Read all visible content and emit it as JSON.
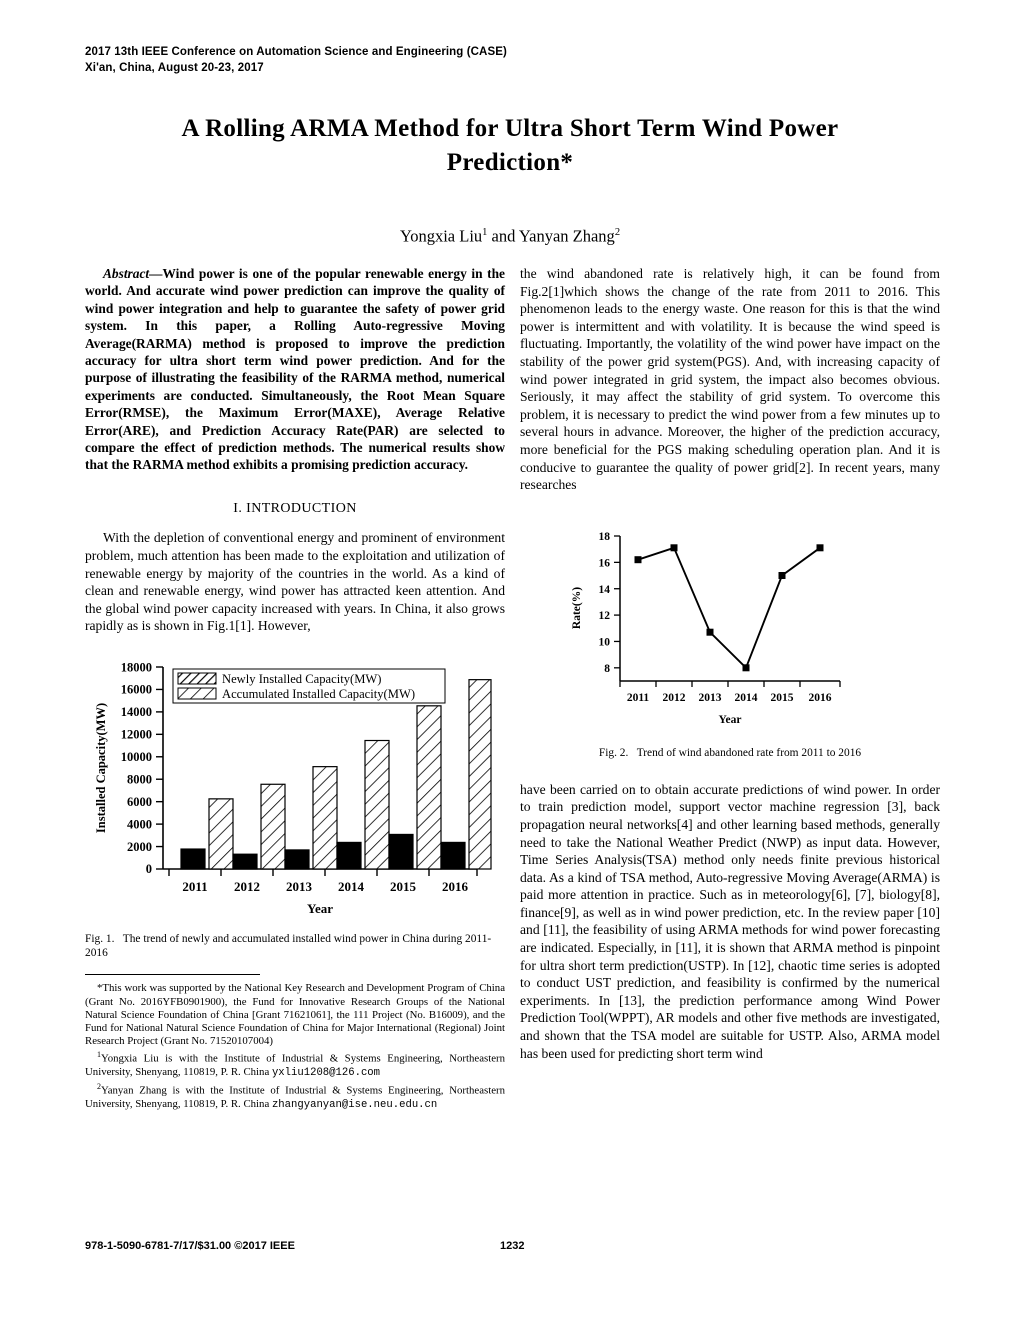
{
  "header": {
    "line1": "2017 13th IEEE Conference on Automation Science and Engineering (CASE)",
    "line2": "Xi'an, China, August 20-23, 2017"
  },
  "title": {
    "line1": "A Rolling ARMA Method for Ultra Short Term Wind Power",
    "line2": "Prediction*",
    "authors_pre": "Yongxia Liu",
    "authors_sup1": "1",
    "authors_mid": " and Yanyan Zhang",
    "authors_sup2": "2"
  },
  "abstract": {
    "lead": "Abstract—",
    "text": "Wind power is one of the popular renewable energy in the world. And accurate wind power prediction can improve the quality of wind power integration and help to guarantee the safety of power grid system. In this paper, a Rolling Auto-regressive Moving Average(RARMA) method is proposed to improve the prediction accuracy for ultra short term wind power prediction. And for the purpose of illustrating the feasibility of the RARMA method, numerical experiments are conducted. Simultaneously, the Root Mean Square Error(RMSE), the Maximum Error(MAXE), Average Relative Error(ARE), and Prediction Accuracy Rate(PAR) are selected to compare the effect of prediction methods. The numerical results show that the RARMA method exhibits a promising prediction accuracy."
  },
  "sections": {
    "introduction_heading": "I.  INTRODUCTION",
    "intro_par1": "With the depletion of conventional energy and prominent of environment problem, much attention has been made to the exploitation and utilization of renewable energy by majority of the countries in the world. As a kind of clean and renewable energy, wind power has attracted keen attention. And the global wind power capacity increased with years. In China, it also grows rapidly as is shown in Fig.1[1]. However,",
    "right_par1": "the wind abandoned rate is relatively high, it can be found from Fig.2[1]which shows the change of the rate from 2011 to 2016. This phenomenon leads to the energy waste. One reason for this is that the wind power is intermittent and with volatility. It is because the wind speed is fluctuating. Importantly, the volatility of the wind power have impact on the stability of the power grid system(PGS). And, with increasing capacity of wind power integrated in grid system, the impact also becomes obvious. Seriously, it may affect the stability of grid system. To overcome this problem, it is necessary to predict the wind power from a few minutes up to several hours in advance. Moreover, the higher of the prediction accuracy, more beneficial for the PGS making scheduling operation plan. And it is conducive to guarantee the quality of power grid[2]. In recent years, many researches",
    "right_par2": "have been carried on to obtain accurate predictions of wind power. In order to train prediction model, support vector machine regression [3], back propagation neural networks[4] and other learning based methods, generally need to take the National Weather Predict (NWP) as input data. However, Time Series Analysis(TSA) method only needs finite previous historical data. As a kind of TSA method, Auto-regressive Moving Average(ARMA) is paid more attention in practice. Such as in meteorology[6], [7], biology[8], finance[9], as well as in wind power prediction, etc. In the review paper [10] and [11], the feasibility of using ARMA methods for wind power forecasting are indicated. Especially, in [11], it is shown that ARMA method is pinpoint for ultra short term prediction(USTP). In [12], chaotic time series is adopted to conduct UST prediction, and feasibility is confirmed by the numerical experiments. In [13], the prediction performance among Wind Power Prediction Tool(WPPT), AR models and other five methods are investigated, and shown that the TSA model are suitable for USTP. Also, ARMA model has been used for predicting short term wind"
  },
  "figures": {
    "fig1_caption_num": "Fig. 1.",
    "fig1_caption_text": "The trend of newly and accumulated installed wind power in China during 2011-2016",
    "fig2_caption_num": "Fig. 2.",
    "fig2_caption_text": "Trend of wind abandoned rate from 2011 to 2016"
  },
  "footnotes": {
    "funding": "*This work was supported by the National Key Research and Development Program of China (Grant No. 2016YFB0901900), the Fund for Innovative Research Groups of the National Natural Science Foundation of China [Grant 71621061], the 111 Project (No. B16009), and the Fund for National Natural Science Foundation of China for Major International (Regional) Joint Research Project (Grant No. 71520107004)",
    "author1_sup": "1",
    "author1": "Yongxia Liu is with the Institute of Industrial & Systems Engineering, Northeastern University, Shenyang, 110819, P. R. China",
    "author1_email": "yxliu1208@126.com",
    "author2_sup": "2",
    "author2": "Yanyan Zhang is with the Institute of Industrial & Systems Engineering, Northeastern University, Shenyang, 110819, P. R. China",
    "author2_email": "zhangyanyan@ise.neu.edu.cn"
  },
  "footer": {
    "isbn": "978-1-5090-6781-7/17/$31.00 ©2017 IEEE",
    "page_number": "1232"
  },
  "chart_data": [
    {
      "type": "bar",
      "title": "",
      "xlabel": "Year",
      "ylabel": "Installed Capacity(MW)",
      "categories": [
        "2011",
        "2012",
        "2013",
        "2014",
        "2015",
        "2016"
      ],
      "ylim": [
        0,
        18000
      ],
      "yticks": [
        0,
        2000,
        4000,
        6000,
        8000,
        10000,
        12000,
        14000,
        16000,
        18000
      ],
      "grid": false,
      "legend_position": "top-left-inside",
      "series": [
        {
          "name": "Newly Installed Capacity(MW)",
          "fill": "solid-black",
          "values": [
            1780,
            1320,
            1700,
            2370,
            3080,
            2370
          ]
        },
        {
          "name": "Accumulated Installed Capacity(MW)",
          "fill": "diagonal-hatch",
          "values": [
            6250,
            7550,
            9120,
            11450,
            14540,
            16870
          ]
        }
      ]
    },
    {
      "type": "line",
      "title": "",
      "xlabel": "Year",
      "ylabel": "Rate(%)",
      "x": [
        "2011",
        "2012",
        "2013",
        "2014",
        "2015",
        "2016"
      ],
      "ylim": [
        7,
        18
      ],
      "yticks": [
        8,
        10,
        12,
        14,
        16,
        18
      ],
      "grid": false,
      "marker": "square",
      "series": [
        {
          "name": "Wind abandoned rate",
          "values": [
            16.2,
            17.1,
            10.7,
            8.0,
            15.0,
            17.1
          ]
        }
      ]
    }
  ]
}
